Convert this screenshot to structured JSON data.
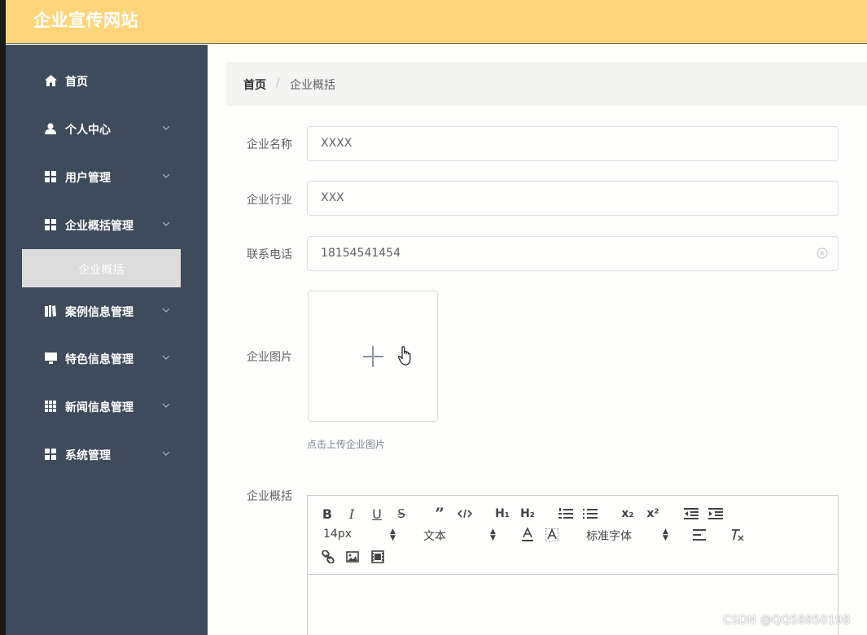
{
  "app": {
    "title": "企业宣传网站"
  },
  "sidebar": {
    "items": [
      {
        "label": "首页",
        "icon": "home-icon",
        "has_children": false
      },
      {
        "label": "个人中心",
        "icon": "user-icon",
        "has_children": true
      },
      {
        "label": "用户管理",
        "icon": "grid-icon",
        "has_children": true
      },
      {
        "label": "企业概括管理",
        "icon": "grid-icon",
        "has_children": true
      },
      {
        "label": "案例信息管理",
        "icon": "book-icon",
        "has_children": true
      },
      {
        "label": "特色信息管理",
        "icon": "monitor-icon",
        "has_children": true
      },
      {
        "label": "新闻信息管理",
        "icon": "grid-9-icon",
        "has_children": true
      },
      {
        "label": "系统管理",
        "icon": "grid-icon",
        "has_children": true
      }
    ],
    "active_sub_item": "企业概括"
  },
  "breadcrumb": {
    "home": "首页",
    "separator": "/",
    "current": "企业概括"
  },
  "form": {
    "name": {
      "label": "企业名称",
      "value": "XXXX"
    },
    "industry": {
      "label": "企业行业",
      "value": "XXX"
    },
    "phone": {
      "label": "联系电话",
      "value": "18154541454"
    },
    "image": {
      "label": "企业图片",
      "tip": "点击上传企业图片"
    },
    "overview": {
      "label": "企业概括"
    }
  },
  "editor": {
    "size_picker": "14px",
    "header_picker": "文本",
    "font_picker": "标准字体"
  },
  "watermark": "CSDN @QQ58850198",
  "colors": {
    "header": "#fed57a",
    "sidebar": "#3f4a5c",
    "active_sub": "#dcdcdc"
  }
}
